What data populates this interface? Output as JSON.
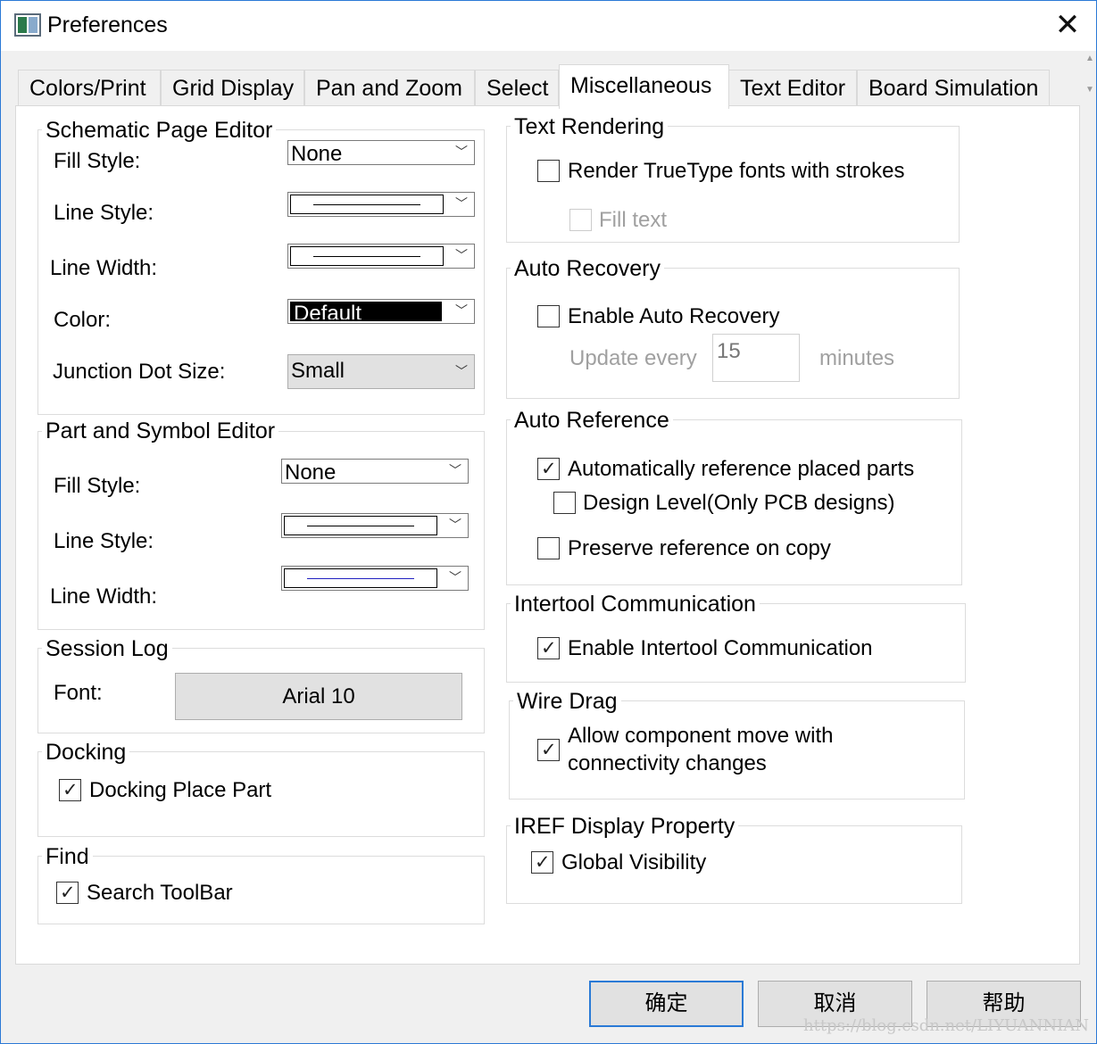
{
  "window": {
    "title": "Preferences",
    "close_icon": "close-icon"
  },
  "tabs": [
    {
      "label": "Colors/Print"
    },
    {
      "label": "Grid Display"
    },
    {
      "label": "Pan and Zoom"
    },
    {
      "label": "Select"
    },
    {
      "label": "Miscellaneous",
      "active": true
    },
    {
      "label": "Text Editor"
    },
    {
      "label": "Board Simulation"
    }
  ],
  "schematic": {
    "title": "Schematic Page Editor",
    "fill_style_label": "Fill Style:",
    "fill_style_value": "None",
    "line_style_label": "Line Style:",
    "line_width_label": "Line Width:",
    "color_label": "Color:",
    "color_value": "Default",
    "junction_label": "Junction Dot Size:",
    "junction_value": "Small"
  },
  "part_symbol": {
    "title": "Part and Symbol Editor",
    "fill_style_label": "Fill Style:",
    "fill_style_value": "None",
    "line_style_label": "Line Style:",
    "line_width_label": "Line Width:"
  },
  "session_log": {
    "title": "Session Log",
    "font_label": "Font:",
    "font_button": "Arial 10"
  },
  "docking": {
    "title": "Docking",
    "place_part_label": "Docking Place Part",
    "place_part_checked": true
  },
  "find": {
    "title": "Find",
    "search_toolbar_label": "Search ToolBar",
    "search_toolbar_checked": true
  },
  "text_rendering": {
    "title": "Text Rendering",
    "truetype_label": "Render TrueType fonts with strokes",
    "truetype_checked": false,
    "fill_text_label": "Fill text",
    "fill_text_checked": false
  },
  "auto_recovery": {
    "title": "Auto Recovery",
    "enable_label": "Enable Auto Recovery",
    "enable_checked": false,
    "update_label": "Update every",
    "update_value": "15",
    "minutes_label": "minutes"
  },
  "auto_reference": {
    "title": "Auto Reference",
    "auto_label": "Automatically reference placed parts",
    "auto_checked": true,
    "design_level_label": "Design Level(Only PCB designs)",
    "design_level_checked": false,
    "preserve_label": "Preserve reference on copy",
    "preserve_checked": false
  },
  "intertool": {
    "title": "Intertool Communication",
    "enable_label": "Enable Intertool Communication",
    "enable_checked": true
  },
  "wire_drag": {
    "title": "Wire Drag",
    "allow_line1": "Allow component move with",
    "allow_line2": "connectivity changes",
    "allow_checked": true
  },
  "iref": {
    "title": "IREF Display Property",
    "global_label": "Global Visibility",
    "global_checked": true
  },
  "buttons": {
    "ok": "确定",
    "cancel": "取消",
    "help": "帮助"
  },
  "watermark": "https://blog.csdn.net/LIYUANNIAN",
  "colors": {
    "accent": "#2a7ad6",
    "disabled_text": "#a0a0a0",
    "panel_bg": "#ffffff",
    "dialog_bg": "#f0f0f0"
  }
}
